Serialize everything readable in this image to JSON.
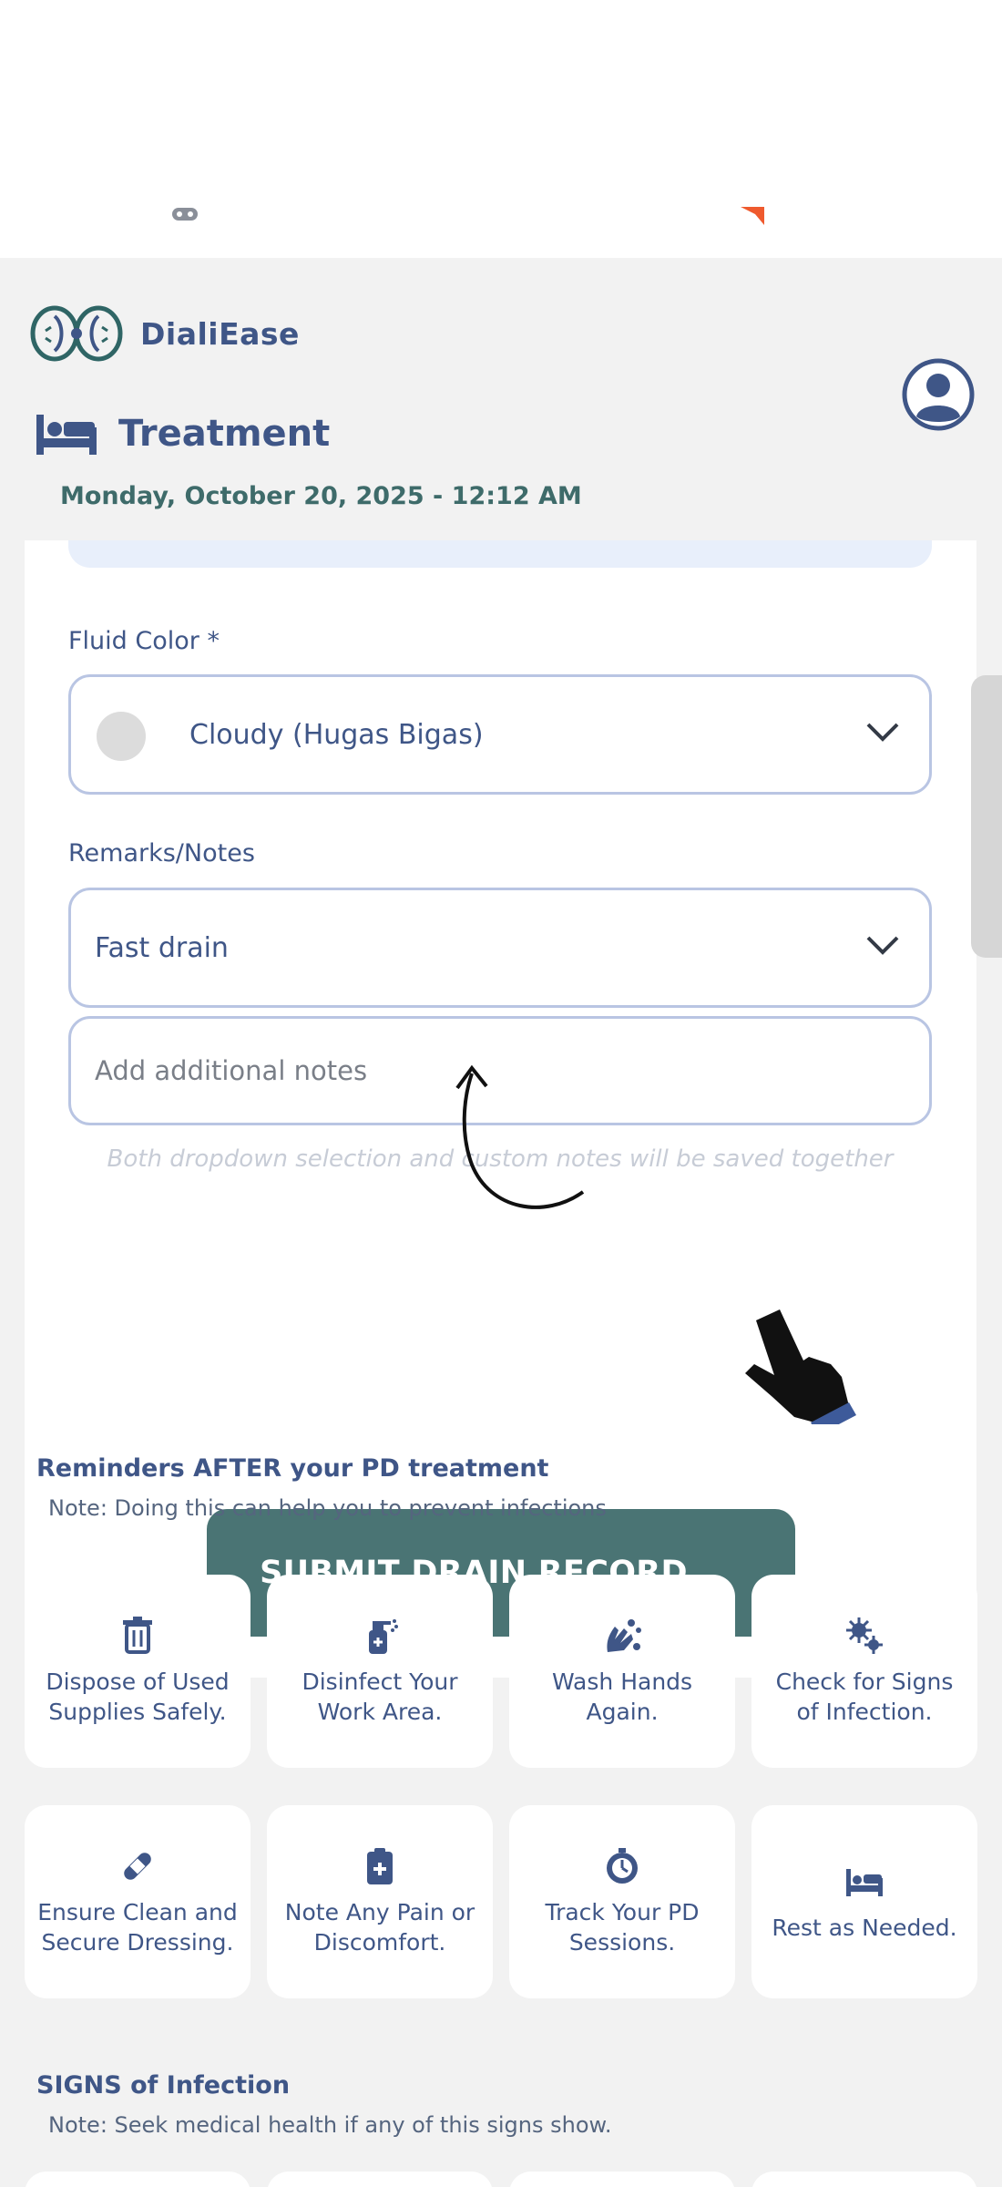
{
  "app": {
    "name": "DialiEase"
  },
  "header": {
    "title": "Treatment",
    "datetime": "Monday, October 20, 2025 - 12:12 AM"
  },
  "form": {
    "fluid_color": {
      "label": "Fluid Color *",
      "value": "Cloudy (Hugas Bigas)",
      "swatch_color": "#dcdcdc"
    },
    "remarks": {
      "label": "Remarks/Notes",
      "value": "Fast drain"
    },
    "notes": {
      "placeholder": "Add additional notes",
      "value": ""
    },
    "hint": "Both dropdown selection and custom notes will be saved together",
    "submit_label": "SUBMIT DRAIN RECORD"
  },
  "reminders": {
    "title": "Reminders AFTER your PD treatment",
    "note": "Note: Doing this can help you to prevent infections",
    "items": [
      {
        "label": "Dispose of Used Supplies Safely.",
        "icon": "trash-icon"
      },
      {
        "label": "Disinfect Your Work Area.",
        "icon": "spray-bottle-icon"
      },
      {
        "label": "Wash Hands Again.",
        "icon": "hand-wash-icon"
      },
      {
        "label": "Check for Signs of Infection.",
        "icon": "virus-icon"
      },
      {
        "label": "Ensure Clean and Secure Dressing.",
        "icon": "bandage-icon"
      },
      {
        "label": "Note Any Pain or Discomfort.",
        "icon": "medical-clipboard-icon"
      },
      {
        "label": "Track Your PD Sessions.",
        "icon": "stopwatch-icon"
      },
      {
        "label": "Rest as Needed.",
        "icon": "bed-icon"
      }
    ]
  },
  "signs": {
    "title": "SIGNS of Infection",
    "note": "Note: Seek medical health if any of this signs show."
  },
  "colors": {
    "primary": "#3f5687",
    "button": "#4a7474",
    "background": "#f2f2f2",
    "border": "#b9c5e3"
  }
}
